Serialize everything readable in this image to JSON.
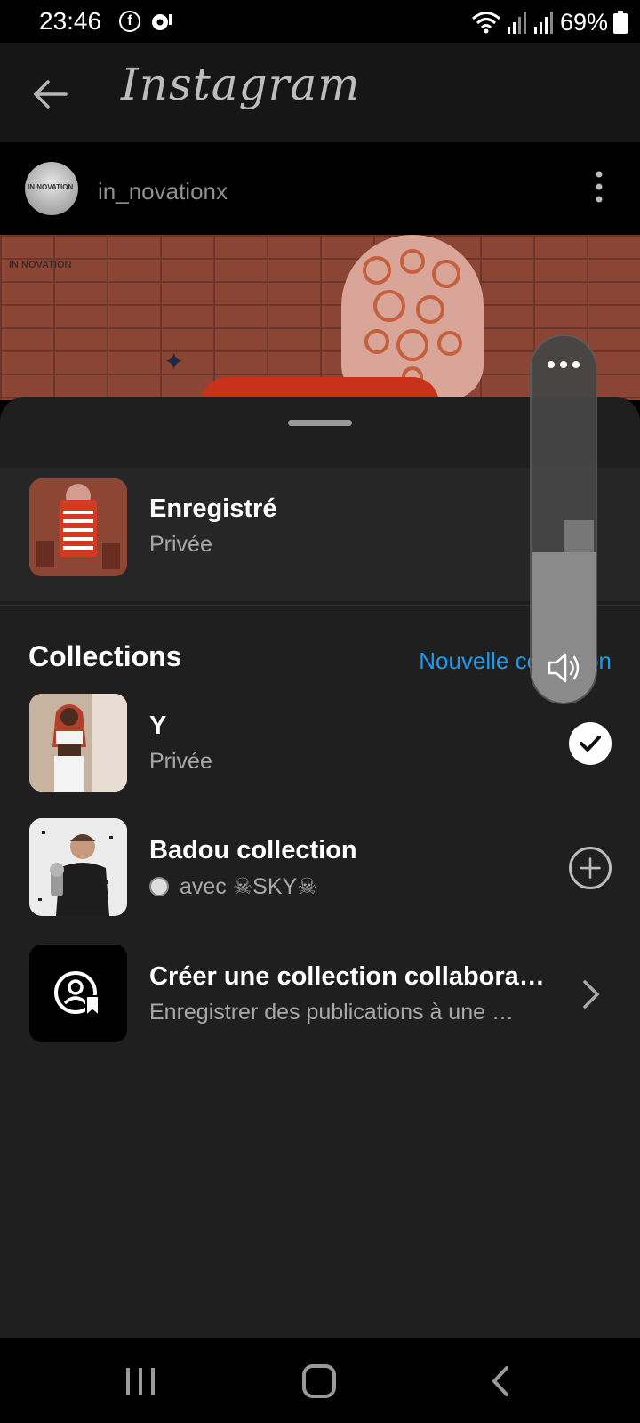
{
  "status_bar": {
    "time": "23:46",
    "battery": "69%",
    "icons": [
      "facebook-icon",
      "app-notification-icon",
      "wifi-icon",
      "signal-icon",
      "signal-icon",
      "battery-icon"
    ]
  },
  "app_bar": {
    "title": "Instagram",
    "back_icon": "arrow-left-icon"
  },
  "post": {
    "username": "in_novationx",
    "watermark": "IN NOVATION",
    "more_icon": "vertical-dots-icon"
  },
  "sheet": {
    "saved": {
      "title": "Enregistré",
      "subtitle": "Privée"
    },
    "collections_header": "Collections",
    "new_collection": "Nouvelle collection",
    "collections": [
      {
        "title": "Y",
        "subtitle": "Privée",
        "action": "checked-icon"
      },
      {
        "title": "Badou collection",
        "subtitle": "avec ☠SKY☠",
        "action": "add-circle-icon"
      },
      {
        "title": "Créer une collection collabora…",
        "subtitle": "Enregistrer des publications à une …",
        "action": "chevron-right-icon"
      }
    ]
  },
  "volume_overlay": {
    "level": 0.41
  },
  "nav_bar": {
    "icons": [
      "recents-icon",
      "home-icon",
      "back-icon"
    ]
  }
}
